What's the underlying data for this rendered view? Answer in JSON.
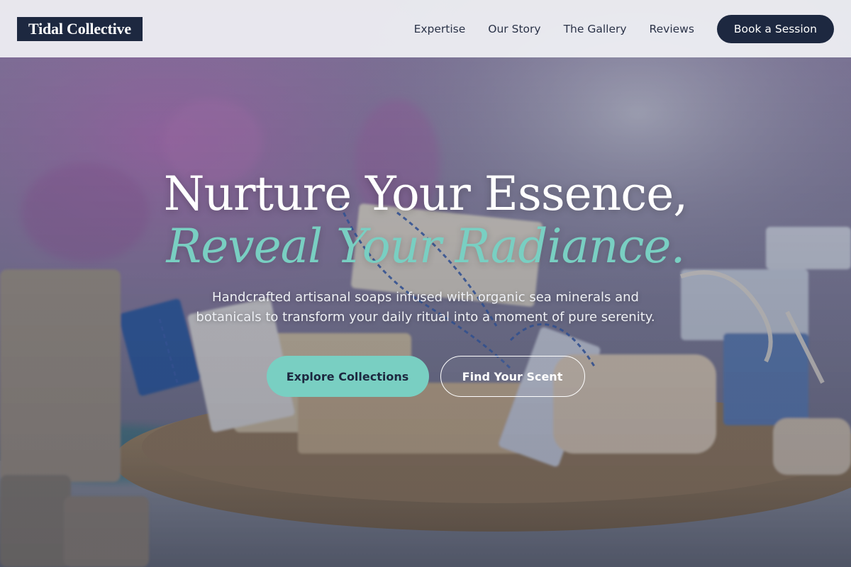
{
  "brand": {
    "name": "Tidal Collective"
  },
  "nav": {
    "links": [
      {
        "label": "Expertise"
      },
      {
        "label": "Our Story"
      },
      {
        "label": "The Gallery"
      },
      {
        "label": "Reviews"
      }
    ],
    "cta_label": "Book a Session"
  },
  "hero": {
    "headline_line1": "Nurture Your Essence,",
    "headline_line2": "Reveal Your Radiance.",
    "subtext": "Handcrafted artisanal soaps infused with organic sea minerals and botanicals to transform your daily ritual into a moment of pure serenity.",
    "primary_button": "Explore Collections",
    "secondary_button": "Find Your Scent",
    "background_image": "artisan-soap-bars-on-wooden-plate"
  },
  "colors": {
    "navy": "#1d2840",
    "teal": "#79cfc2",
    "header_bg": "#f0f1f4",
    "white": "#ffffff"
  }
}
